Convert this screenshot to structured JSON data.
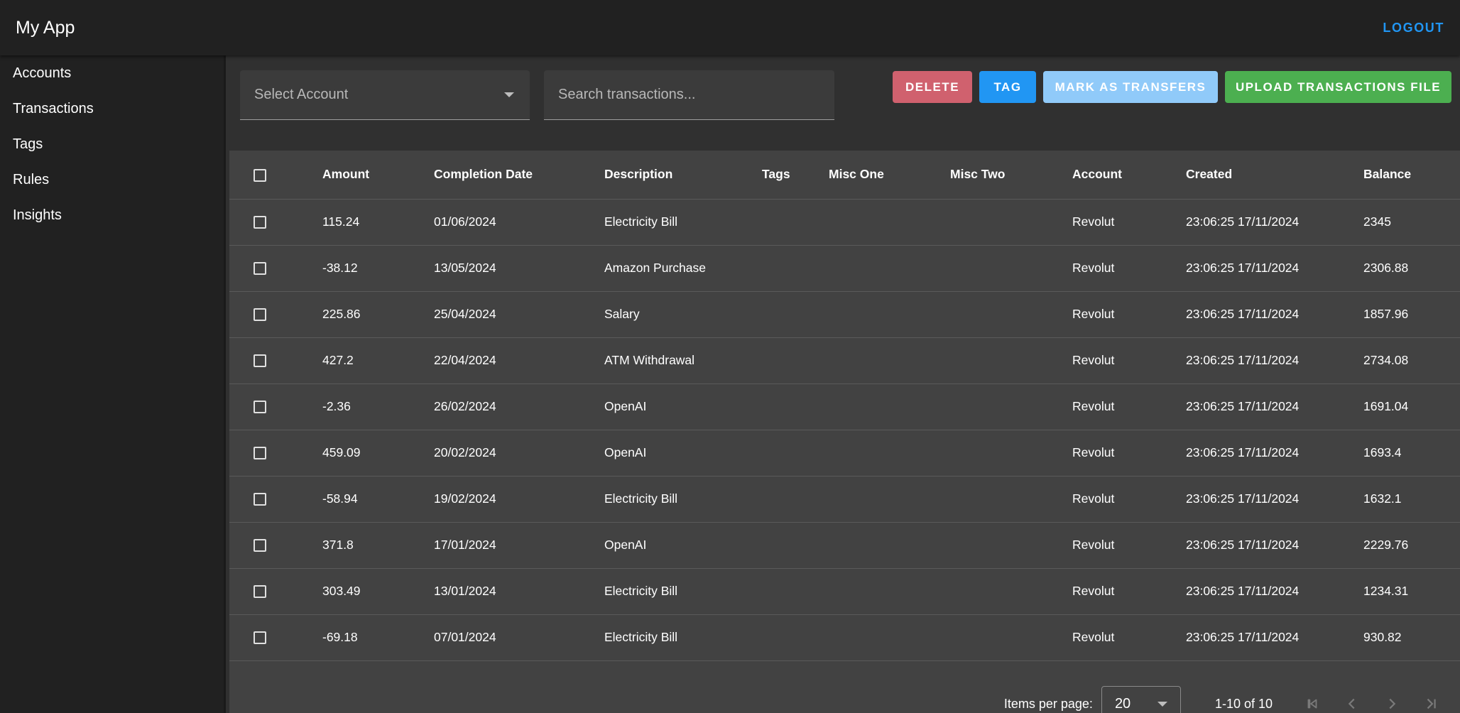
{
  "header": {
    "title": "My App",
    "logout_label": "LOGOUT"
  },
  "sidebar": {
    "items": [
      {
        "label": "Accounts"
      },
      {
        "label": "Transactions"
      },
      {
        "label": "Tags"
      },
      {
        "label": "Rules"
      },
      {
        "label": "Insights"
      }
    ]
  },
  "toolbar": {
    "account_select_placeholder": "Select Account",
    "search_placeholder": "Search transactions...",
    "delete_label": "DELETE",
    "tag_label": "TAG",
    "transfer_label": "MARK AS TRANSFERS",
    "upload_label": "UPLOAD TRANSACTIONS FILE"
  },
  "table": {
    "columns": [
      "Amount",
      "Completion Date",
      "Description",
      "Tags",
      "Misc One",
      "Misc Two",
      "Account",
      "Created",
      "Balance"
    ],
    "rows": [
      {
        "amount": "115.24",
        "date": "01/06/2024",
        "description": "Electricity Bill",
        "tags": "",
        "misc_one": "",
        "misc_two": "",
        "account": "Revolut",
        "created": "23:06:25 17/11/2024",
        "balance": "2345"
      },
      {
        "amount": "-38.12",
        "date": "13/05/2024",
        "description": "Amazon Purchase",
        "tags": "",
        "misc_one": "",
        "misc_two": "",
        "account": "Revolut",
        "created": "23:06:25 17/11/2024",
        "balance": "2306.88"
      },
      {
        "amount": "225.86",
        "date": "25/04/2024",
        "description": "Salary",
        "tags": "",
        "misc_one": "",
        "misc_two": "",
        "account": "Revolut",
        "created": "23:06:25 17/11/2024",
        "balance": "1857.96"
      },
      {
        "amount": "427.2",
        "date": "22/04/2024",
        "description": "ATM Withdrawal",
        "tags": "",
        "misc_one": "",
        "misc_two": "",
        "account": "Revolut",
        "created": "23:06:25 17/11/2024",
        "balance": "2734.08"
      },
      {
        "amount": "-2.36",
        "date": "26/02/2024",
        "description": "OpenAI",
        "tags": "",
        "misc_one": "",
        "misc_two": "",
        "account": "Revolut",
        "created": "23:06:25 17/11/2024",
        "balance": "1691.04"
      },
      {
        "amount": "459.09",
        "date": "20/02/2024",
        "description": "OpenAI",
        "tags": "",
        "misc_one": "",
        "misc_two": "",
        "account": "Revolut",
        "created": "23:06:25 17/11/2024",
        "balance": "1693.4"
      },
      {
        "amount": "-58.94",
        "date": "19/02/2024",
        "description": "Electricity Bill",
        "tags": "",
        "misc_one": "",
        "misc_two": "",
        "account": "Revolut",
        "created": "23:06:25 17/11/2024",
        "balance": "1632.1"
      },
      {
        "amount": "371.8",
        "date": "17/01/2024",
        "description": "OpenAI",
        "tags": "",
        "misc_one": "",
        "misc_two": "",
        "account": "Revolut",
        "created": "23:06:25 17/11/2024",
        "balance": "2229.76"
      },
      {
        "amount": "303.49",
        "date": "13/01/2024",
        "description": "Electricity Bill",
        "tags": "",
        "misc_one": "",
        "misc_two": "",
        "account": "Revolut",
        "created": "23:06:25 17/11/2024",
        "balance": "1234.31"
      },
      {
        "amount": "-69.18",
        "date": "07/01/2024",
        "description": "Electricity Bill",
        "tags": "",
        "misc_one": "",
        "misc_two": "",
        "account": "Revolut",
        "created": "23:06:25 17/11/2024",
        "balance": "930.82"
      }
    ]
  },
  "paginator": {
    "items_per_page_label": "Items per page:",
    "items_per_page_value": "20",
    "range_label": "1-10 of 10"
  },
  "colors": {
    "accent": "#2196f3",
    "delete": "#d0616e",
    "transfer": "#90caf9",
    "upload": "#4caf50"
  },
  "icons": {
    "select_caret": "chevron-down-icon",
    "first_page": "first-page-icon",
    "prev_page": "chevron-left-icon",
    "next_page": "chevron-right-icon",
    "last_page": "last-page-icon"
  }
}
